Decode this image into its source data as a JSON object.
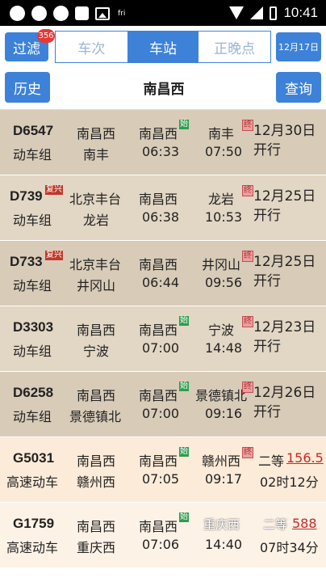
{
  "status_bar": {
    "time": "10:41",
    "tiny_label": "fri"
  },
  "toolbar": {
    "filter_label": "过滤",
    "filter_badge": "356",
    "tabs": [
      {
        "label": "车次",
        "active": false
      },
      {
        "label": "车站",
        "active": true
      },
      {
        "label": "正晚点",
        "active": false
      }
    ],
    "date_label": "12月17日",
    "history_label": "历史",
    "station": "南昌西",
    "query_label": "查询"
  },
  "colors": {
    "accent": "#3d82d8",
    "dong_row": "#d8cbb8",
    "gao_row": "#fcebd8",
    "price": "#c62828"
  },
  "trains": [
    {
      "code": "D6547",
      "type": "动车组",
      "from": "南昌西",
      "to": "南丰",
      "station": "南昌西",
      "start_tag": "始",
      "dep": "06:33",
      "end_station": "南丰",
      "end_tag": "终",
      "arr": "07:50",
      "info": "12月30日开行"
    },
    {
      "code": "D739",
      "type": "动车组",
      "code_tag": "复兴",
      "from": "北京丰台",
      "to": "龙岩",
      "station": "南昌西",
      "dep": "06:38",
      "end_station": "龙岩",
      "end_tag": "终",
      "arr": "10:53",
      "info": "12月25日开行"
    },
    {
      "code": "D733",
      "type": "动车组",
      "code_tag": "复兴",
      "from": "北京丰台",
      "to": "井冈山",
      "station": "南昌西",
      "dep": "06:44",
      "end_station": "井冈山",
      "end_tag": "终",
      "arr": "09:56",
      "info": "12月25日开行"
    },
    {
      "code": "D3303",
      "type": "动车组",
      "from": "南昌西",
      "to": "宁波",
      "station": "南昌西",
      "start_tag": "始",
      "dep": "07:00",
      "end_station": "宁波",
      "end_tag": "终",
      "arr": "14:48",
      "info": "12月23日开行"
    },
    {
      "code": "D6258",
      "type": "动车组",
      "from": "南昌西",
      "to": "景德镇北",
      "station": "南昌西",
      "start_tag": "始",
      "dep": "07:00",
      "end_station": "景德镇北",
      "end_tag": "终",
      "arr": "09:16",
      "info": "12月26日开行"
    },
    {
      "code": "G5031",
      "type": "高速动车",
      "from": "南昌西",
      "to": "赣州西",
      "station": "南昌西",
      "start_tag": "始",
      "dep": "07:05",
      "end_station": "赣州西",
      "end_tag": "终",
      "arr": "09:17",
      "seat": "二等",
      "price": "156.5",
      "duration": "02时12分"
    },
    {
      "code": "G1759",
      "type": "高速动车",
      "from": "南昌西",
      "to": "重庆西",
      "station": "南昌西",
      "start_tag": "始",
      "dep": "07:06",
      "end_station": "",
      "arr": "14:40",
      "seat": "二等",
      "price": "588",
      "duration": "07时34分",
      "overlay": "重庆西"
    }
  ]
}
